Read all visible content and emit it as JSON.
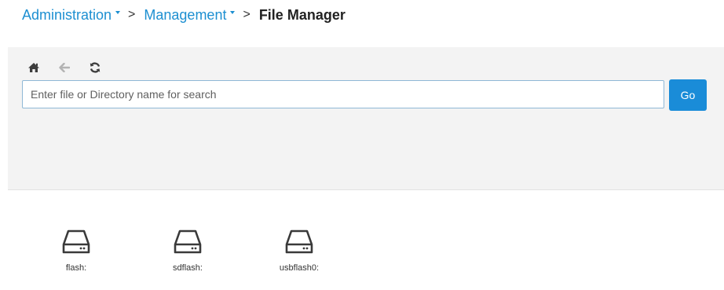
{
  "breadcrumb": {
    "items": [
      {
        "label": "Administration",
        "has_dropdown": true
      },
      {
        "label": "Management",
        "has_dropdown": true
      },
      {
        "label": "File Manager",
        "current": true
      }
    ],
    "separator": ">"
  },
  "toolbar": {
    "icons": [
      "home-icon",
      "back-arrow-icon",
      "refresh-icon"
    ]
  },
  "search": {
    "value": "",
    "placeholder": "Enter file or Directory name for search",
    "button_label": "Go"
  },
  "drives": [
    {
      "label": "flash:",
      "icon": "hard-drive-icon"
    },
    {
      "label": "sdflash:",
      "icon": "hard-drive-icon"
    },
    {
      "label": "usbflash0:",
      "icon": "hard-drive-icon"
    }
  ],
  "colors": {
    "link": "#1d8fd1",
    "button": "#1a8cd8",
    "panel_bg": "#f3f3f3",
    "input_border": "#8fb8d6"
  }
}
